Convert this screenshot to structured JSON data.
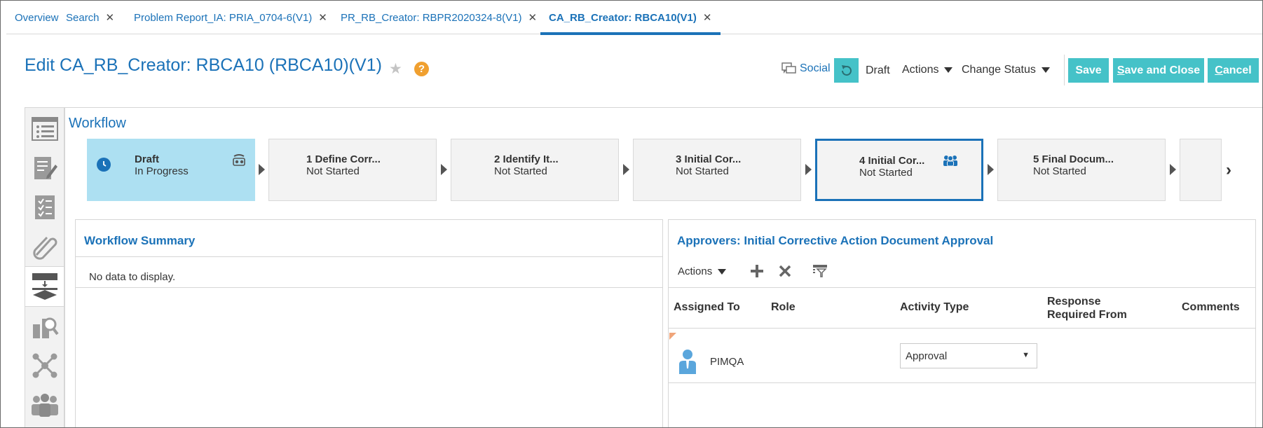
{
  "tabs": [
    {
      "label": "Overview",
      "closable": false,
      "active": false
    },
    {
      "label": "Search",
      "closable": true,
      "active": false
    },
    {
      "label": "Problem Report_IA: PRIA_0704-6(V1)",
      "closable": true,
      "active": false
    },
    {
      "label": "PR_RB_Creator: RBPR2020324-8(V1)",
      "closable": true,
      "active": false
    },
    {
      "label": "CA_RB_Creator: RBCA10(V1)",
      "closable": true,
      "active": true
    }
  ],
  "header": {
    "title": "Edit CA_RB_Creator: RBCA10 (RBCA10)(V1)",
    "social_label": "Social",
    "status_label": "Draft",
    "actions_label": "Actions",
    "change_status_label": "Change Status",
    "save_label": "Save",
    "save_close_label": {
      "underlined": "S",
      "rest": "ave and Close"
    },
    "cancel_label": {
      "underlined": "C",
      "rest": "ancel"
    }
  },
  "workflow": {
    "title": "Workflow",
    "steps": [
      {
        "name": "Draft",
        "status": "In Progress"
      },
      {
        "name": "1 Define Corr...",
        "status": "Not Started"
      },
      {
        "name": "2 Identify It...",
        "status": "Not Started"
      },
      {
        "name": "3 Initial Cor...",
        "status": "Not Started"
      },
      {
        "name": "4 Initial Cor...",
        "status": "Not Started"
      },
      {
        "name": "5 Final Docum...",
        "status": "Not Started"
      }
    ]
  },
  "summary": {
    "title": "Workflow Summary",
    "empty_text": "No data to display."
  },
  "approvers": {
    "title": "Approvers: Initial Corrective Action Document Approval",
    "actions_label": "Actions",
    "columns": [
      "Assigned To",
      "Role",
      "Activity Type",
      "Response Required From",
      "Comments"
    ],
    "rows": [
      {
        "assigned_to": "PIMQA",
        "role": "",
        "activity_type": "Approval",
        "response_required_from": "",
        "comments": ""
      }
    ]
  },
  "colors": {
    "accent": "#1b72b8",
    "button": "#45c2c8",
    "current_step": "#ade0f2",
    "help": "#f0a030"
  },
  "icons": [
    "close-icon",
    "star-icon",
    "help-icon",
    "social-icon",
    "refresh-icon",
    "list-icon",
    "edit-icon",
    "checklist-icon",
    "attachment-icon",
    "workflow-icon",
    "search-doc-icon",
    "network-icon",
    "group-icon",
    "clock-icon",
    "people-icon",
    "plus-icon",
    "delete-icon",
    "filter-icon",
    "user-icon"
  ]
}
